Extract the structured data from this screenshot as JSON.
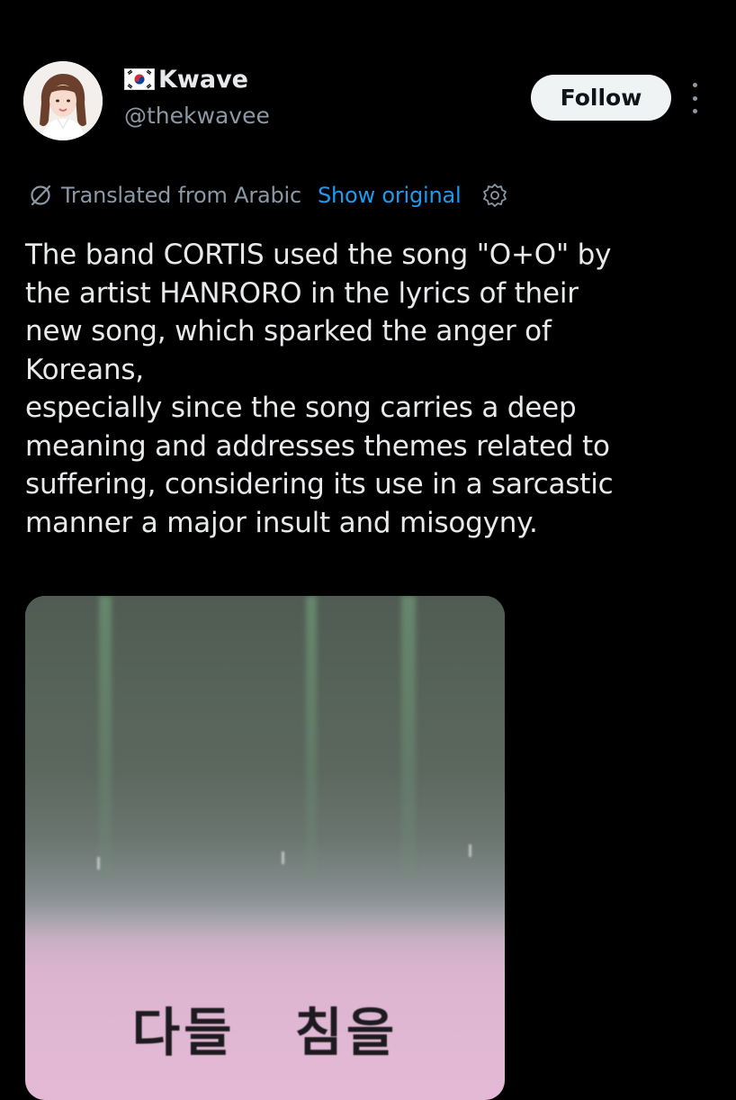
{
  "author": {
    "flag_icon": "south-korea-flag-icon",
    "display_name": "Kwave",
    "handle": "@thekwavee",
    "avatar_icon": "profile-photo"
  },
  "actions": {
    "follow_label": "Follow",
    "more_icon": "more-vertical-icon"
  },
  "translation": {
    "icon": "translate-icon",
    "label": "Translated from Arabic",
    "show_original_label": "Show original",
    "settings_icon": "gear-icon"
  },
  "post": {
    "lines": [
      "The band CORTIS used the song \"O+O\" by",
      "the artist HANRORO in the lyrics of their",
      "new song, which sparked the anger of",
      "Koreans,",
      "especially since the song carries a deep",
      "meaning and addresses themes related to",
      "suffering, considering its use in a sarcastic",
      "manner a major insult and misogyny."
    ]
  },
  "media": {
    "caption_words": [
      "다들",
      "침을"
    ]
  },
  "colors": {
    "background": "#000000",
    "text": "#e7e9ea",
    "secondary": "#8b98a5",
    "link": "#1d9bf0",
    "follow_bg": "#eff3f4"
  }
}
